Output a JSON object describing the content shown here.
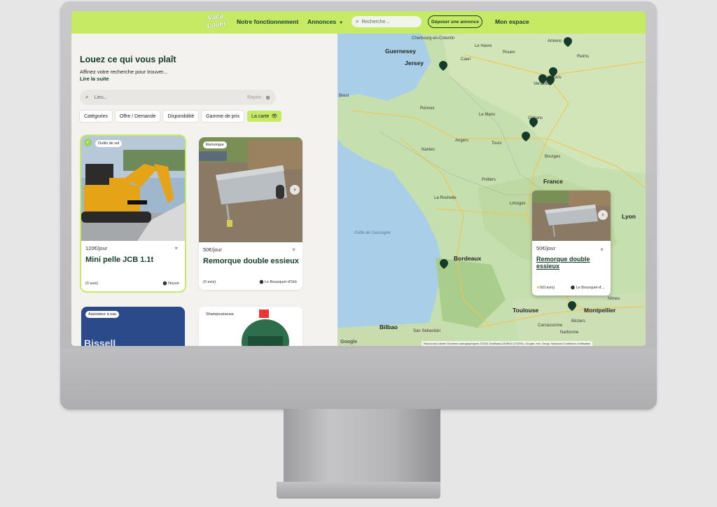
{
  "nav": {
    "logo_line1": "Vaca",
    "logo_line2": "Louer",
    "how_it_works": "Notre fonctionnement",
    "listings": "Annonces",
    "search_placeholder": "Recherche...",
    "deposit": "Déposer une annonce",
    "my_space": "Mon espace"
  },
  "intro": {
    "title": "Louez ce qui vous plaît",
    "subtitle": "Affinez votre recherche pour trouver...",
    "read_more": "Lire la suite"
  },
  "location_search": {
    "placeholder": "Lieu...",
    "radius_label": "Rayon"
  },
  "filters": [
    "Catégories",
    "Offre / Demande",
    "Disponibilité",
    "Gamme de prix",
    "La carte"
  ],
  "cards": [
    {
      "badge": "Outils de sol",
      "price": "120€/jour",
      "title": "Mini pelle JCB 1.1t",
      "reviews": "(0 avis)",
      "city": "Noyon"
    },
    {
      "badge": "Remorque",
      "price": "50€/jour",
      "title": "Remorque double essieux",
      "reviews": "(0 avis)",
      "city": "Le Bousquet-d'Orb"
    },
    {
      "badge": "Aspirateur à eau",
      "img_text": "Bissell"
    },
    {
      "badge": "Shampouineuse"
    }
  ],
  "map": {
    "labels": [
      "Guernesey",
      "Jersey",
      "Cherbourg-en-Cotentin",
      "Le Havre",
      "Caen",
      "Rouen",
      "Amiens",
      "Reims",
      "Versailles",
      "Paris",
      "Brest",
      "Rennes",
      "Le Mans",
      "Orléans",
      "Nantes",
      "Tours",
      "Angers",
      "Bourges",
      "France",
      "Poitiers",
      "La Rochelle",
      "Limoges",
      "Bordeaux",
      "Lyon",
      "Toulouse",
      "Montpellier",
      "Nîmes",
      "Béziers",
      "Narbonne",
      "Carcassonne",
      "Bilbao",
      "San Sebastián",
      "Golfe de Gascogne"
    ],
    "google": "Google",
    "footer": "Raccourcis clavier   Données cartographiques ©2024 GeoBasis-DE/BKG (©2009), Google, Inst. Geogr. Nacional   Conditions d'utilisation"
  },
  "map_card": {
    "price": "50€/jour",
    "title": "Remorque double essieux",
    "reviews": "0(0 avis)",
    "city": "Le Bousquet-d'..."
  }
}
